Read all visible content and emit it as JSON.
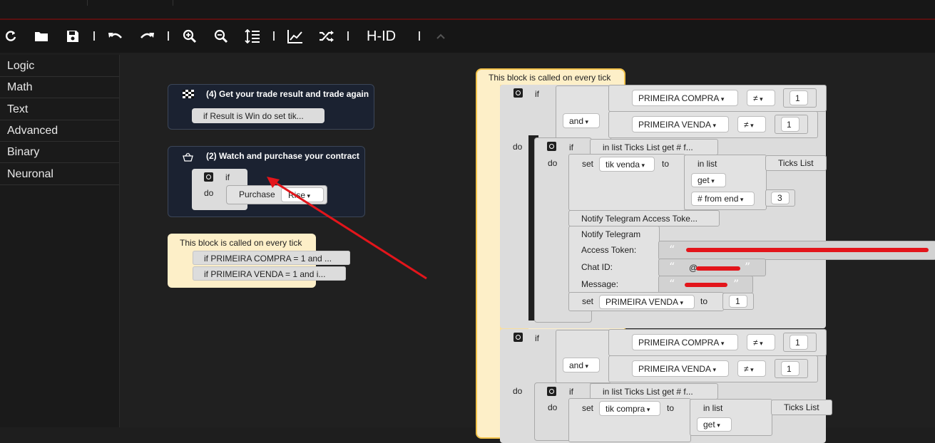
{
  "toolbar": {
    "brand": "H-ID"
  },
  "colors": {
    "accent_red": "#e3151b",
    "yellow_block": "#fdefc8",
    "yellow_border": "#f3c34a",
    "dark_block": "#1b2231"
  },
  "icons": [
    "refresh-icon",
    "folder-icon",
    "save-icon",
    "undo-icon",
    "redo-icon",
    "zoom-in-icon",
    "zoom-out-icon",
    "sort-icon",
    "chart-icon",
    "shuffle-icon",
    "chevron-up-icon"
  ],
  "sidebar": {
    "items": [
      {
        "label": "Logic"
      },
      {
        "label": "Math"
      },
      {
        "label": "Text"
      },
      {
        "label": "Advanced"
      },
      {
        "label": "Binary"
      },
      {
        "label": "Neuronal"
      }
    ]
  },
  "left": {
    "block4": {
      "title": "(4) Get your trade result and trade again",
      "stmt": "if Result is Win do set tik..."
    },
    "block2": {
      "title": "(2) Watch and purchase your contract",
      "if": "if",
      "do": "do",
      "purchase": "Purchase",
      "rise": "Rise"
    },
    "tick": {
      "header": "This block is called on every tick",
      "line1": "if PRIMEIRA COMPRA = 1 and ...",
      "line2": "if PRIMEIRA VENDA = 1 and i..."
    }
  },
  "right": {
    "header": "This block is called on every tick",
    "if_kw": "if",
    "do_kw": "do",
    "and_kw": "and",
    "var_compra": "PRIMEIRA COMPRA",
    "var_venda": "PRIMEIRA VENDA",
    "neq": "≠",
    "one": "1",
    "inner_if": "in list Ticks List get  # f...",
    "set_kw": "set",
    "to_kw": "to",
    "tik_venda": "tik venda",
    "tik_compra": "tik compra",
    "in_list": "in list",
    "ticks_list": "Ticks List",
    "get": "get",
    "from_end": "# from end",
    "three": "3",
    "notify_collapsed": "Notify Telegram Access Toke...",
    "notify_title": "Notify Telegram",
    "access_token": "Access Token:",
    "chat_id": "Chat ID:",
    "message": "Message:",
    "chat_prefix": "@"
  }
}
